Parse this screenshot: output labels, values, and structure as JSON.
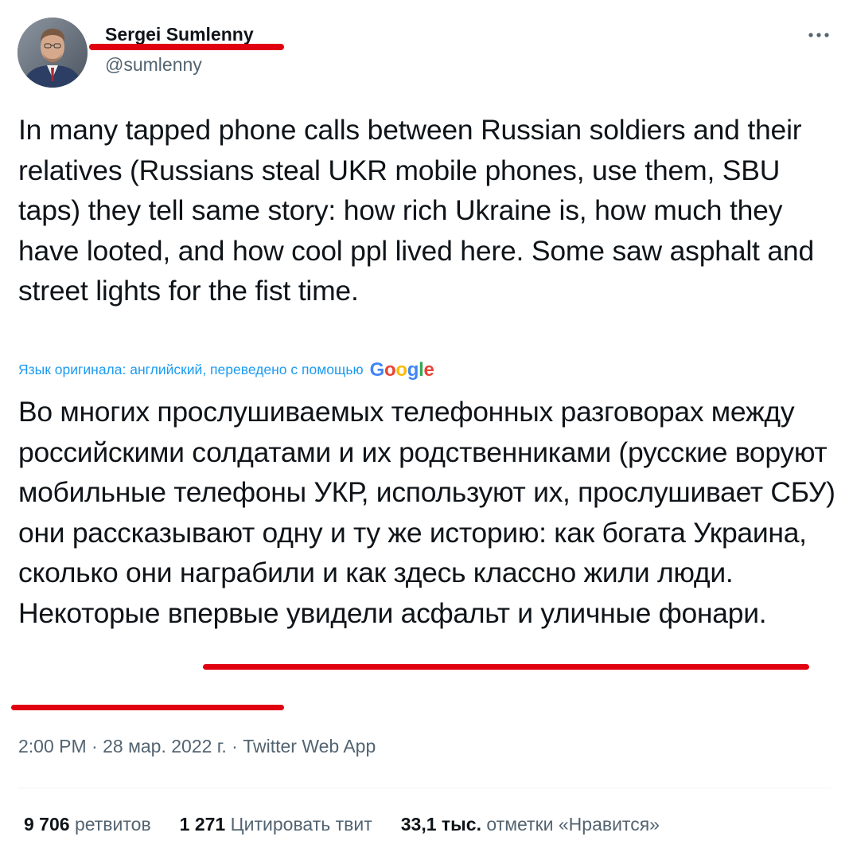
{
  "author": {
    "display_name": "Sergei Sumlenny",
    "handle": "@sumlenny"
  },
  "tweet": {
    "text": "In many tapped phone calls between Russian soldiers and their relatives (Russians steal UKR mobile phones, use them, SBU taps) they tell same story: how rich Ukraine is, how much they have looted, and how cool ppl lived here. Some saw asphalt and street lights for the fist time.",
    "translation_label": "Язык оригинала: английский, переведено с помощью",
    "translation_provider": "Google",
    "translated_text": "Во многих прослушиваемых телефонных разговорах между российскими солдатами и их родственниками (русские воруют мобильные телефоны УКР, используют их, прослушивает СБУ) они рассказывают одну и ту же историю: как богата Украина, сколько они награбили и как здесь классно жили люди.",
    "translated_highlight": "Некоторые впервые увидели асфальт и уличные фонари.",
    "meta": "2:00 PM · 28 мар. 2022 г. · Twitter Web App"
  },
  "stats": {
    "retweets_count": "9 706",
    "retweets_label": "ретвитов",
    "quotes_count": "1 271",
    "quotes_label": "Цитировать твит",
    "likes_count": "33,1 тыс.",
    "likes_label": "отметки «Нравится»"
  },
  "icons": {
    "more": "more-horizontal-icon"
  },
  "colors": {
    "text": "#0f1419",
    "secondary": "#536471",
    "link": "#1d9bf0",
    "annotation_red": "#e0000f"
  }
}
